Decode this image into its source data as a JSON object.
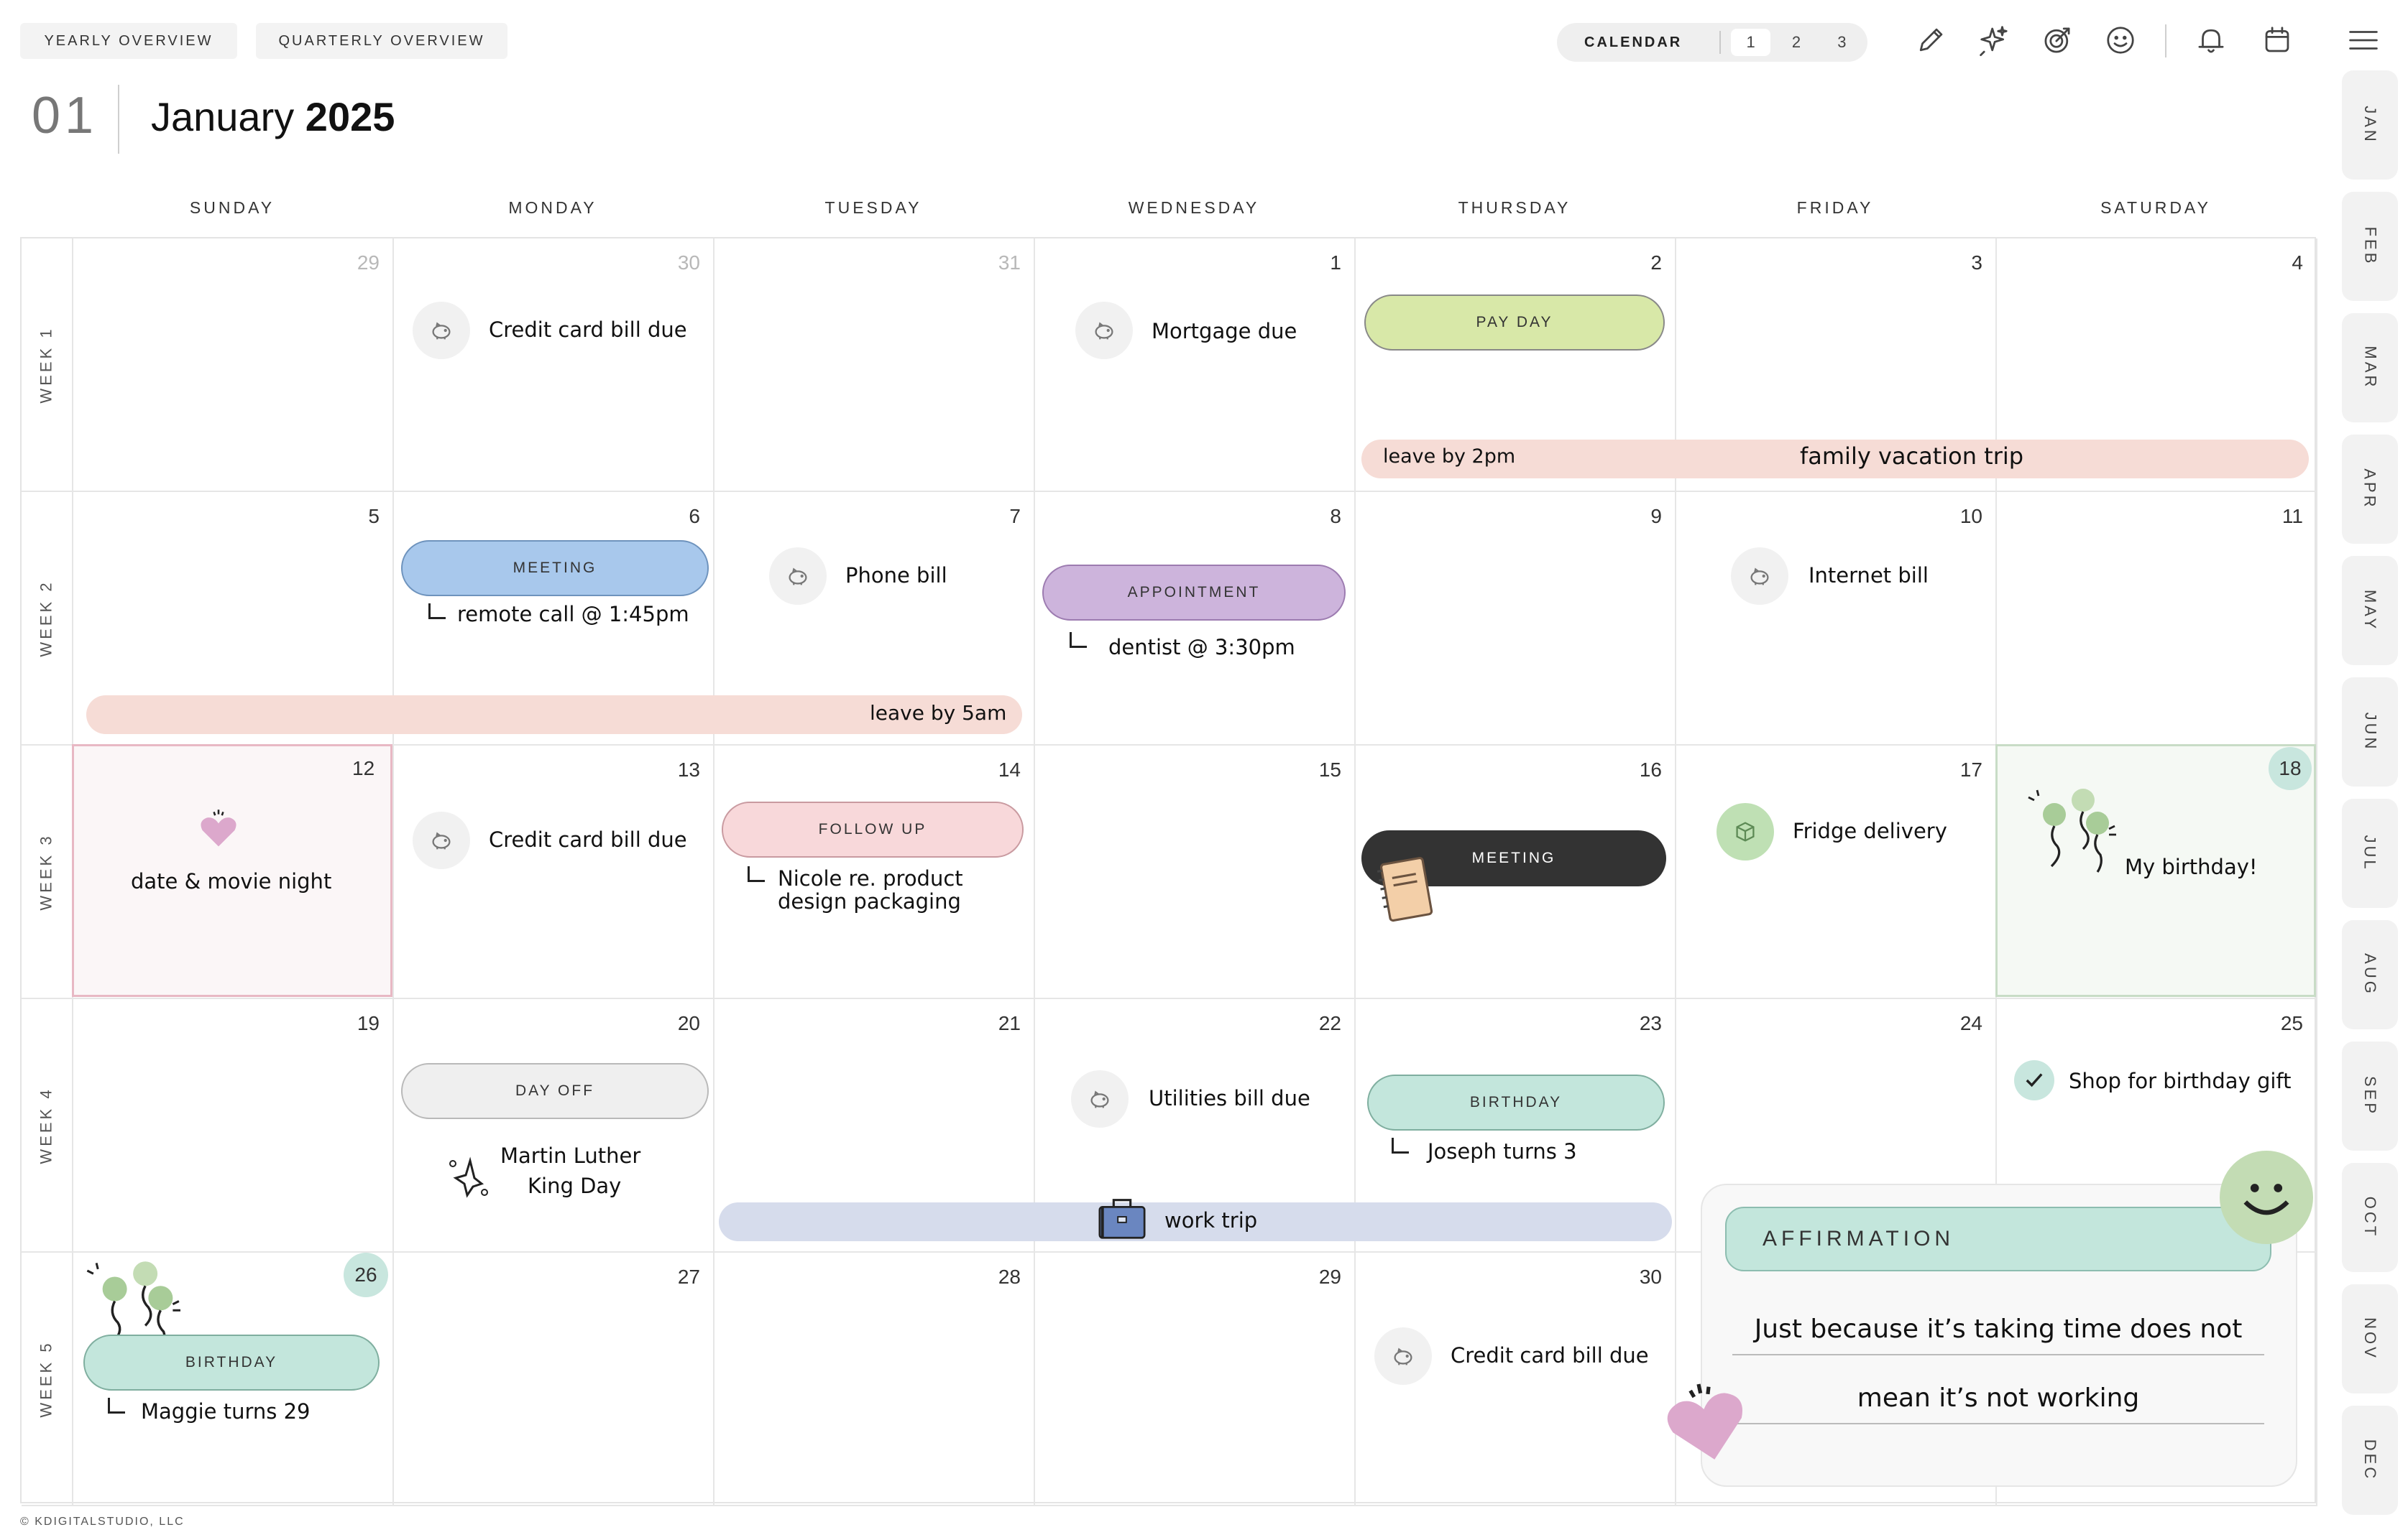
{
  "top": {
    "yearly": "YEARLY OVERVIEW",
    "quarterly": "QUARTERLY OVERVIEW",
    "calendar_label": "CALENDAR",
    "calendars": [
      "1",
      "2",
      "3"
    ]
  },
  "month": {
    "number": "01",
    "name": "January",
    "year": "2025"
  },
  "days": [
    "SUNDAY",
    "MONDAY",
    "TUESDAY",
    "WEDNESDAY",
    "THURSDAY",
    "FRIDAY",
    "SATURDAY"
  ],
  "weeks": [
    "WEEK 1",
    "WEEK 2",
    "WEEK 3",
    "WEEK 4",
    "WEEK 5"
  ],
  "dates": [
    [
      "29",
      "30",
      "31",
      "1",
      "2",
      "3",
      "4"
    ],
    [
      "5",
      "6",
      "7",
      "8",
      "9",
      "10",
      "11"
    ],
    [
      "12",
      "13",
      "14",
      "15",
      "16",
      "17",
      "18"
    ],
    [
      "19",
      "20",
      "21",
      "22",
      "23",
      "24",
      "25"
    ],
    [
      "26",
      "27",
      "28",
      "29",
      "30",
      "",
      ""
    ]
  ],
  "events": {
    "cc1": "Credit card bill due",
    "mortgage": "Mortgage due",
    "payday": "PAY DAY",
    "leave2pm": "leave by 2pm",
    "vacation": "family vacation trip",
    "meeting1": "MEETING",
    "remote": "remote call @ 1:45pm",
    "phone": "Phone bill",
    "appointment": "APPOINTMENT",
    "dentist": "dentist @ 3:30pm",
    "internet": "Internet bill",
    "leave5am": "leave by 5am",
    "datenight": "date & movie night",
    "cc2": "Credit card bill due",
    "followup": "FOLLOW UP",
    "nicole1": "Nicole re. product",
    "nicole2": "design packaging",
    "meeting2": "MEETING",
    "fridge": "Fridge delivery",
    "mybday": "My birthday!",
    "dayoff": "DAY OFF",
    "mlk1": "Martin Luther",
    "mlk2": "King Day",
    "utilities": "Utilities bill due",
    "birthday1": "BIRTHDAY",
    "joseph": "Joseph turns 3",
    "giftshop": "Shop for birthday gift",
    "worktrip": "work trip",
    "birthday2": "BIRTHDAY",
    "maggie": "Maggie turns 29",
    "cc3": "Credit card bill due"
  },
  "affirmation": {
    "title": "AFFIRMATION",
    "line1": "Just because it’s taking time does not",
    "line2": "mean it’s not working"
  },
  "months": [
    "JAN",
    "FEB",
    "MAR",
    "APR",
    "MAY",
    "JUN",
    "JUL",
    "AUG",
    "SEP",
    "OCT",
    "NOV",
    "DEC"
  ],
  "copyright": "© KDIGITALSTUDIO, LLC",
  "colors": {
    "payday": "#d8e8a8",
    "meeting_blue": "#a8c8ec",
    "appointment": "#cdb4dc",
    "followup": "#f8d8da",
    "meeting_dark": "#333333",
    "birthday": "#c3e6dc",
    "dayoff": "#efefef",
    "vacation_bar": "#f6dcd6",
    "worktrip_bar": "#d6dcec"
  },
  "icons": [
    "pencil-icon",
    "sparkle-icon",
    "target-icon",
    "smiley-icon",
    "bell-icon",
    "calendar-icon",
    "menu-icon",
    "piggy-bank-icon",
    "heart-icon",
    "box-icon",
    "balloons-icon",
    "checkmark-icon",
    "briefcase-icon",
    "notebook-icon"
  ]
}
